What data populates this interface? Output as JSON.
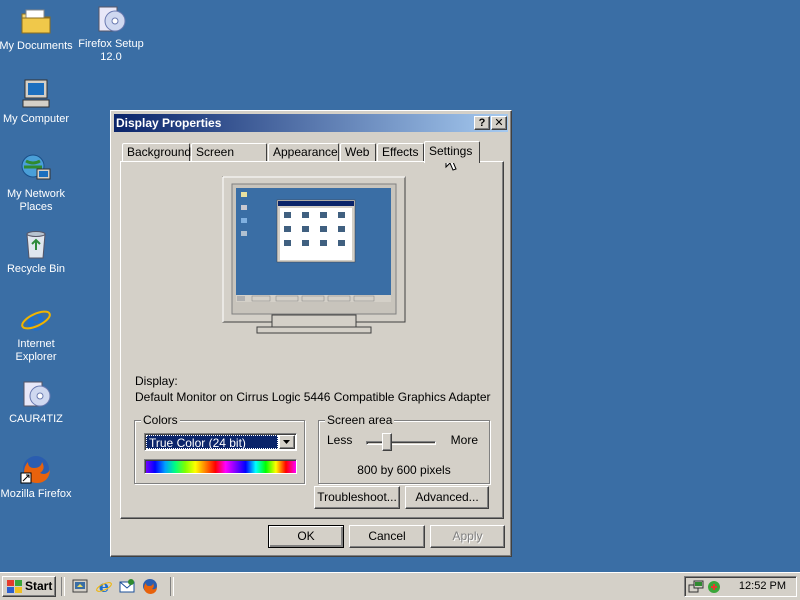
{
  "desktop": {
    "icons": [
      {
        "label": "My Documents",
        "icon": "folder-documents-icon"
      },
      {
        "label": "Firefox Setup 12.0",
        "icon": "setup-installer-icon"
      },
      {
        "label": "My Computer",
        "icon": "computer-icon"
      },
      {
        "label": "My Network Places",
        "icon": "network-places-icon"
      },
      {
        "label": "Recycle Bin",
        "icon": "recycle-bin-icon"
      },
      {
        "label": "Internet Explorer",
        "icon": "internet-explorer-icon"
      },
      {
        "label": "CAUR4TIZ",
        "icon": "setup-installer-icon"
      },
      {
        "label": "Mozilla Firefox",
        "icon": "firefox-icon"
      }
    ],
    "background_color": "#3a6ea5"
  },
  "dialog": {
    "title": "Display Properties",
    "help_button": "?",
    "close_button": "✕",
    "tabs": [
      "Background",
      "Screen Saver",
      "Appearance",
      "Web",
      "Effects",
      "Settings"
    ],
    "active_tab": "Settings",
    "display_label": "Display:",
    "display_value": "Default Monitor on Cirrus Logic 5446 Compatible Graphics Adapter",
    "colors": {
      "title": "Colors",
      "selected": "True Color (24 bit)"
    },
    "screen_area": {
      "title": "Screen area",
      "less_label": "Less",
      "more_label": "More",
      "resolution_text": "800 by 600 pixels",
      "slider_fraction": 0.3
    },
    "troubleshoot_button": "Troubleshoot...",
    "advanced_button": "Advanced...",
    "ok_button": "OK",
    "cancel_button": "Cancel",
    "apply_button": "Apply"
  },
  "taskbar": {
    "start_label": "Start",
    "clock": "12:52 PM",
    "quick_launch": [
      "show-desktop-icon",
      "internet-explorer-icon",
      "outlook-express-icon",
      "firefox-icon"
    ],
    "tray_icons": [
      "network-tray-icon",
      "volume-tray-icon"
    ]
  },
  "colors": {
    "window_face": "#d4d0c8",
    "title_active_start": "#0a246a",
    "title_active_end": "#a6caf0",
    "selection": "#0a246a"
  }
}
